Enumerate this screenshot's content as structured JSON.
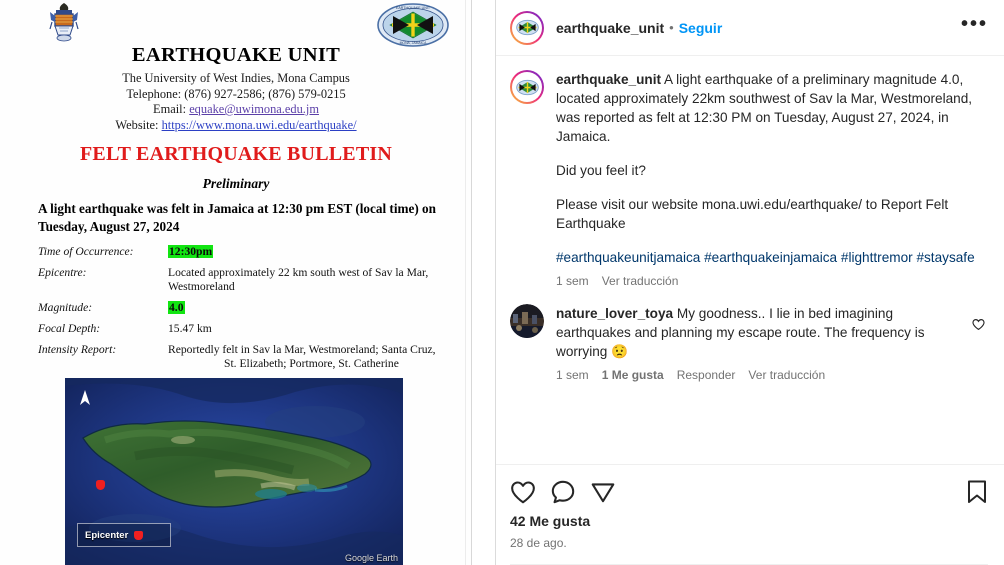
{
  "post_media": {
    "document": {
      "org_title": "EARTHQUAKE UNIT",
      "org_affiliation": "The University of West Indies, Mona Campus",
      "telephone": "Telephone: (876) 927-2586; (876) 579-0215",
      "email_label": "Email:",
      "email_value": "equake@uwimona.edu.jm",
      "website_label": "Website:",
      "website_value": "https://www.mona.uwi.edu/earthquake/",
      "bulletin_title": "FELT EARTHQUAKE BULLETIN",
      "bulletin_status": "Preliminary",
      "lead": "A light earthquake was felt in Jamaica at 12:30 pm EST (local time) on Tuesday, August 27, 2024",
      "fields": [
        {
          "label": "Time of Occurrence:",
          "value": "12:30pm",
          "highlight": true
        },
        {
          "label": "Epicentre:",
          "value": "Located approximately 22 km south west of Sav la Mar, Westmoreland",
          "highlight": false
        },
        {
          "label": "Magnitude:",
          "value": "4.0",
          "highlight": true
        },
        {
          "label": "Focal Depth:",
          "value": "15.47 km",
          "highlight": false
        },
        {
          "label": "Intensity Report:",
          "value": "Reportedly felt in Sav la Mar, Westmoreland; Santa Cruz,",
          "value_line2": "St. Elizabeth; Portmore, St. Catherine",
          "highlight": false
        }
      ],
      "map": {
        "legend_label": "Epicenter",
        "watermark": "Google Earth",
        "north_icon": "north-arrow-icon",
        "epicenter_marker": "epicenter-marker-icon"
      },
      "logos": {
        "left": "uwi-crest-logo",
        "right": "earthquake-unit-logo"
      },
      "colors": {
        "bulletin_red": "#e01b1b",
        "highlight_green": "#12e512",
        "link_blue": "#2b3fc4"
      }
    }
  },
  "side_panel": {
    "header": {
      "username": "earthquake_unit",
      "separator": "•",
      "follow_label": "Seguir",
      "more_icon": "more-options-icon",
      "avatar": "account-avatar"
    },
    "caption": {
      "username": "earthquake_unit",
      "paragraph_1": " A light earthquake of a preliminary magnitude 4.0, located approximately 22km southwest of Sav la Mar, Westmoreland, was reported as felt at 12:30 PM on Tuesday, August 27, 2024, in Jamaica.",
      "paragraph_2": "Did you feel it?",
      "paragraph_3": "Please visit our website mona.uwi.edu/earthquake/ to Report Felt Earthquake",
      "hashtags": "#earthquakeunitjamaica #earthquakeinjamaica #lighttremor #staysafe",
      "time_ago": "1 sem",
      "translate_label": "Ver traducción"
    },
    "comments": [
      {
        "username": "nature_lover_toya",
        "text": " My goodness.. I lie in bed imagining earthquakes and planning my escape route. The frequency is worrying 😟",
        "time_ago": "1 sem",
        "likes_label": "1 Me gusta",
        "reply_label": "Responder",
        "translate_label": "Ver traducción",
        "like_icon": "comment-like-heart-icon"
      }
    ],
    "actions": {
      "like_icon": "like-heart-icon",
      "comment_icon": "comment-bubble-icon",
      "share_icon": "share-paper-plane-icon",
      "save_icon": "save-bookmark-icon",
      "likes_count": "42 Me gusta",
      "post_date": "28 de ago."
    },
    "colors": {
      "link_blue": "#0095f6",
      "hashtag_blue": "#00376b",
      "secondary_text": "#737373"
    }
  }
}
